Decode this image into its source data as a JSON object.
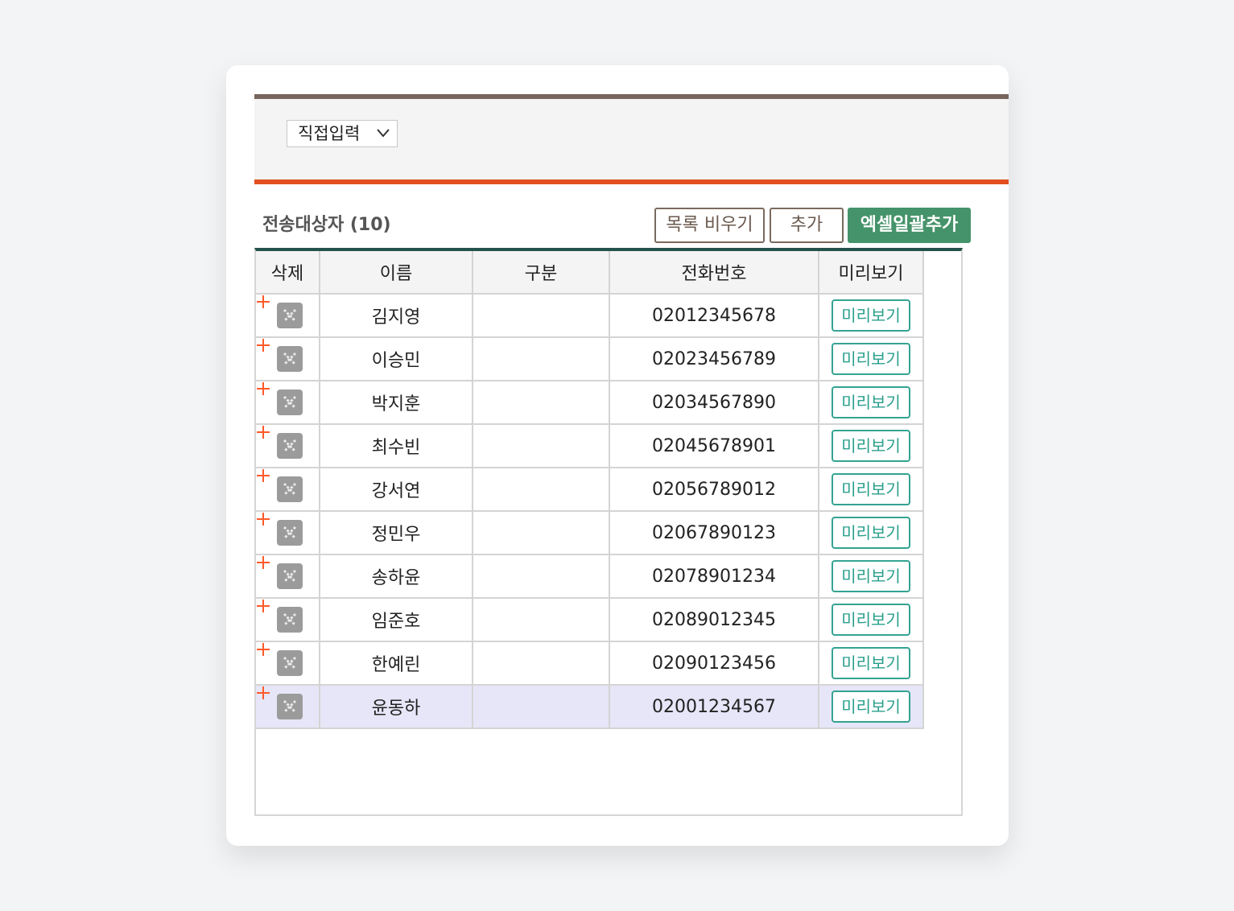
{
  "input_mode": {
    "selected": "직접입력"
  },
  "section": {
    "title": "전송대상자 (10)"
  },
  "buttons": {
    "clear": "목록 비우기",
    "add": "추가",
    "excel_add": "엑셀일괄추가"
  },
  "colors": {
    "topbar_border": "#76665b",
    "accent_border": "#e1501e",
    "green_button": "#45936a",
    "preview_teal": "#2a9f8c",
    "table_top_border": "#23524a",
    "selected_row": "#e6e6f8"
  },
  "table": {
    "headers": [
      "삭제",
      "이름",
      "구분",
      "전화번호",
      "미리보기"
    ],
    "rows": [
      {
        "name": "김지영",
        "category": "",
        "phone": "02012345678",
        "preview": "미리보기"
      },
      {
        "name": "이승민",
        "category": "",
        "phone": "02023456789",
        "preview": "미리보기"
      },
      {
        "name": "박지훈",
        "category": "",
        "phone": "02034567890",
        "preview": "미리보기"
      },
      {
        "name": "최수빈",
        "category": "",
        "phone": "02045678901",
        "preview": "미리보기"
      },
      {
        "name": "강서연",
        "category": "",
        "phone": "02056789012",
        "preview": "미리보기"
      },
      {
        "name": "정민우",
        "category": "",
        "phone": "02067890123",
        "preview": "미리보기"
      },
      {
        "name": "송하윤",
        "category": "",
        "phone": "02078901234",
        "preview": "미리보기"
      },
      {
        "name": "임준호",
        "category": "",
        "phone": "02089012345",
        "preview": "미리보기"
      },
      {
        "name": "한예린",
        "category": "",
        "phone": "02090123456",
        "preview": "미리보기"
      },
      {
        "name": "윤동하",
        "category": "",
        "phone": "02001234567",
        "preview": "미리보기",
        "selected": true
      }
    ]
  }
}
